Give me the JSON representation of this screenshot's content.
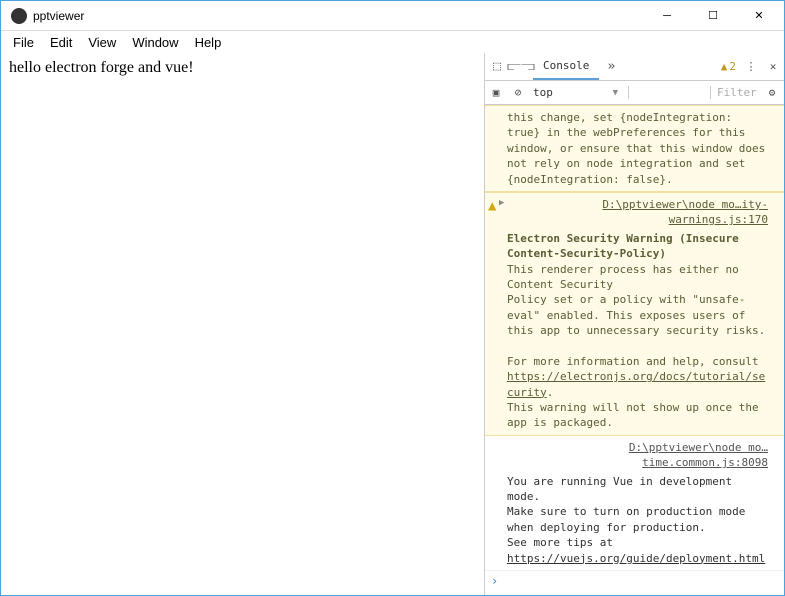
{
  "titlebar": {
    "title": "pptviewer"
  },
  "menubar": {
    "items": [
      "File",
      "Edit",
      "View",
      "Window",
      "Help"
    ]
  },
  "main": {
    "text": "hello electron forge and vue!"
  },
  "devtools": {
    "tabs": {
      "console": "Console",
      "warn_count": "2"
    },
    "toolbar": {
      "context": "top",
      "filter_placeholder": "Filter"
    },
    "messages": {
      "w1_text": "this change, set {nodeIntegration: true} in the webPreferences for this window, or ensure that this window does not rely on node integration and set {nodeIntegration: false}.",
      "w2_src": "D:\\pptviewer\\node mo…ity-warnings.js:170",
      "w2_title": "Electron Security Warning (Insecure Content-Security-Policy)",
      "w2_l1": "This renderer process has either no Content Security",
      "w2_l2": "    Policy set or a policy with \"unsafe-eval\" enabled. This exposes users of",
      "w2_l3": "    this app to unnecessary security risks.",
      "w2_l4": "For more information and help, consult",
      "w2_link": "https://electronjs.org/docs/tutorial/security",
      "w2_l5": ".",
      "w2_l6": " This warning will not show up once the app is packaged.",
      "log_src": "D:\\pptviewer\\node mo…time.common.js:8098",
      "log_l1": "You are running Vue in development mode.",
      "log_l2": "Make sure to turn on production mode when deploying for production.",
      "log_l3": "See more tips at ",
      "log_link": "https://vuejs.org/guide/deployment.html"
    }
  }
}
